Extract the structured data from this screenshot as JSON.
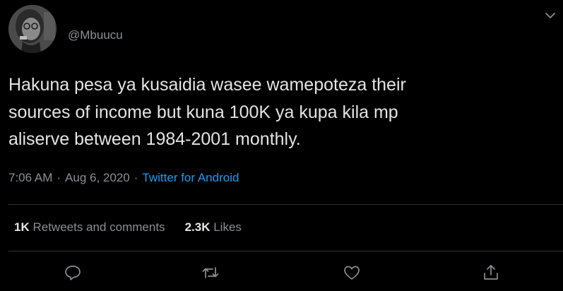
{
  "tweet": {
    "handle": "@Mbuucu",
    "text": "Hakuna pesa ya kusaidia wasee wamepoteza their\nsources of income but kuna 100K ya kupa kila mp\naliserve between 1984-2001 monthly.",
    "time": "7:06 AM",
    "date": "Aug 6, 2020",
    "separator": "·",
    "source": "Twitter for Android",
    "retweets_count": "1K",
    "retweets_label": "Retweets and comments",
    "likes_count": "2.3K",
    "likes_label": "Likes"
  },
  "icons": {
    "caret": "chevron-down-icon",
    "reply": "reply-icon",
    "retweet": "retweet-icon",
    "like": "heart-icon",
    "share": "share-icon"
  },
  "colors": {
    "background": "#000000",
    "text": "#e4e4e4",
    "secondary": "#8a8f94",
    "link": "#1d9bf0",
    "divider": "#2f3336"
  }
}
